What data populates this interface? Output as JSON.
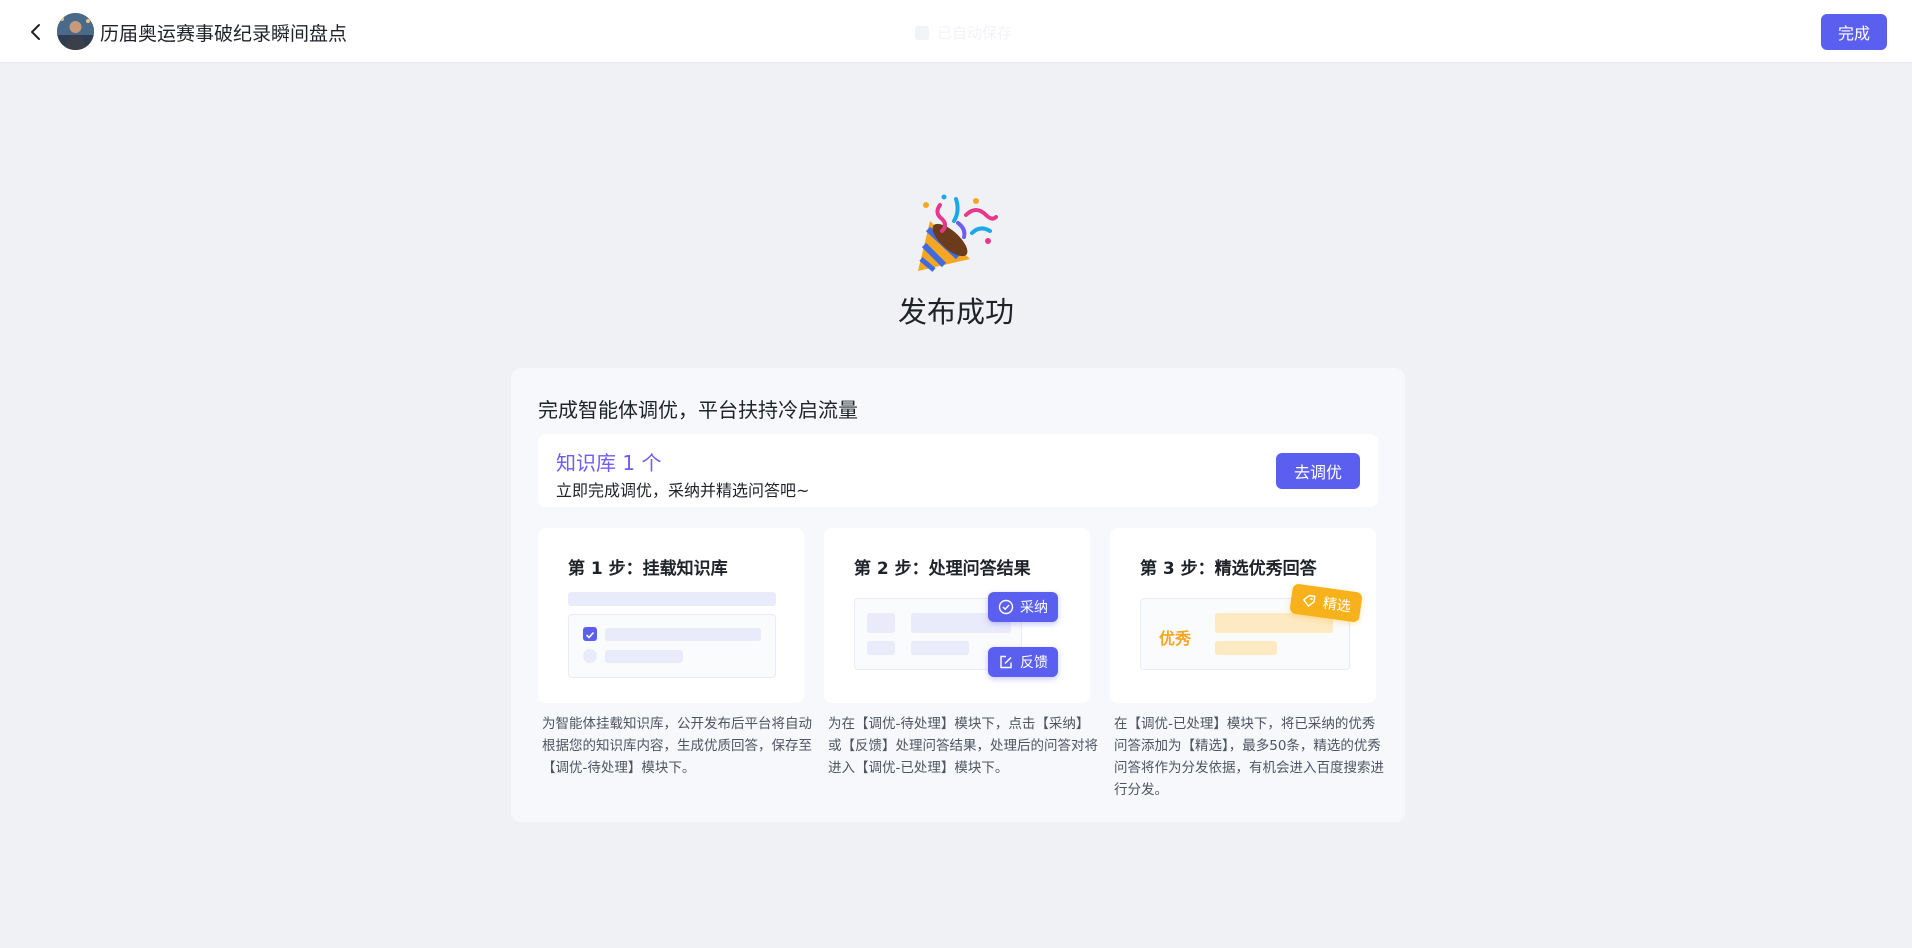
{
  "header": {
    "title": "历届奥运赛事破纪录瞬间盘点",
    "status_text": "已自动保存",
    "done_label": "完成"
  },
  "hero": {
    "title": "发布成功"
  },
  "panel": {
    "title": "完成智能体调优，平台扶持冷启流量",
    "knowledge": {
      "title": "知识库 1 个",
      "subtitle": "立即完成调优，采纳并精选问答吧~",
      "button_label": "去调优"
    },
    "steps": [
      {
        "title": "第 1 步：挂载知识库",
        "description": "为智能体挂载知识库，公开发布后平台将自动根据您的知识库内容，生成优质回答，保存至【调优-待处理】模块下。"
      },
      {
        "title": "第 2 步：处理问答结果",
        "description": "为在【调优-待处理】模块下，点击【采纳】或【反馈】处理问答结果，处理后的问答对将进入【调优-已处理】模块下。",
        "adopt_label": "采纳",
        "feedback_label": "反馈"
      },
      {
        "title": "第 3 步：精选优秀回答",
        "description": "在【调优-已处理】模块下，将已采纳的优秀问答添加为【精选】，最多50条，精选的优秀问答将作为分发依据，有机会进入百度搜索进行分发。",
        "excellent_label": "优秀",
        "select_label": "精选"
      }
    ]
  },
  "colors": {
    "accent": "#5b5ff0",
    "kb_title": "#6e5cf6",
    "highlight": "#f7b21b",
    "background": "#f0f1f5"
  },
  "icons": {
    "back": "chevron-left-icon",
    "celebrate": "party-popper-icon",
    "adopt": "check-circle-icon",
    "feedback": "edit-icon",
    "select": "tag-icon"
  }
}
